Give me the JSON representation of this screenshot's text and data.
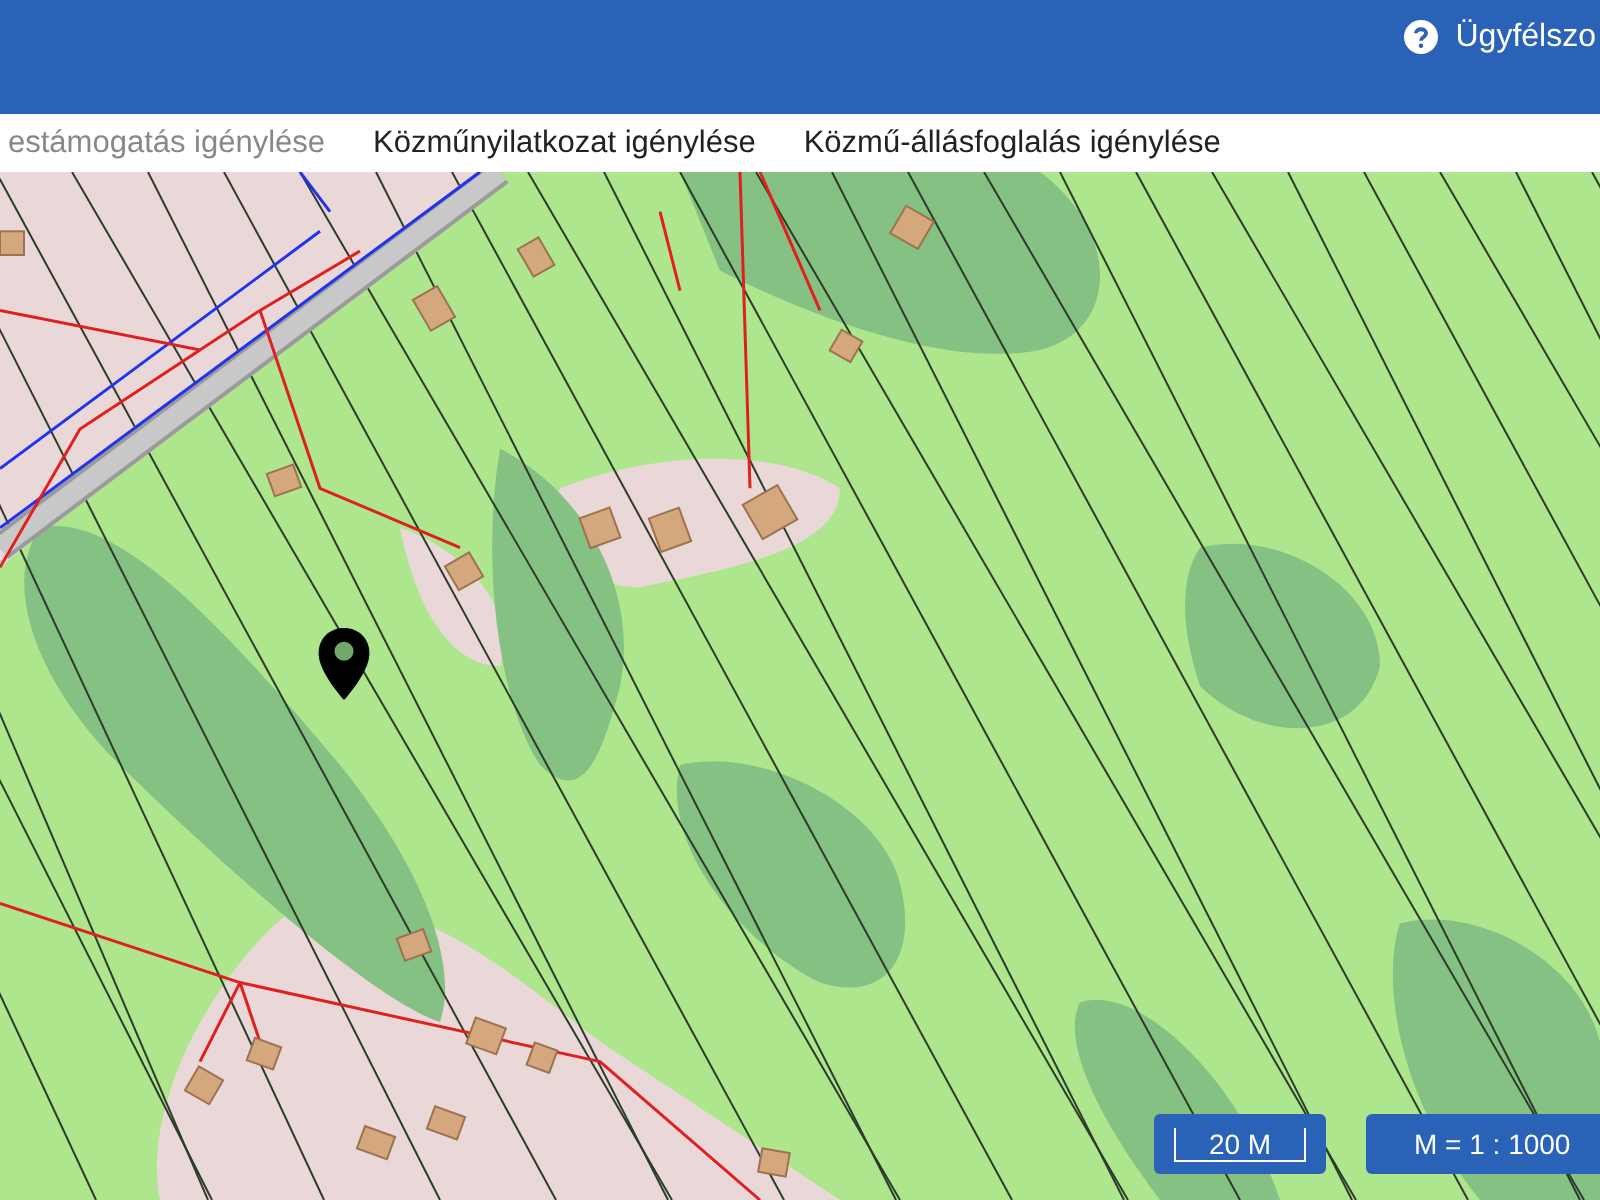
{
  "header": {
    "help_label": "Ügyfélszo"
  },
  "tabs": [
    {
      "label": "estámogatás igénylése",
      "disabled": true
    },
    {
      "label": "Közműnyilatkozat igénylése",
      "disabled": false
    },
    {
      "label": "Közmű-állásfoglalás igénylése",
      "disabled": false
    }
  ],
  "map": {
    "scale_label": "20 M",
    "ratio_label": "M = 1 : 1000"
  }
}
